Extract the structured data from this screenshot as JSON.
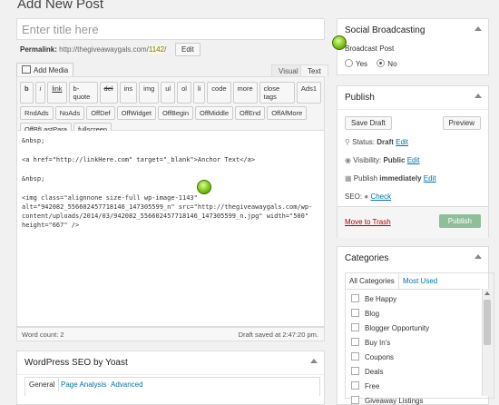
{
  "header": {
    "title": "Add New Post"
  },
  "title_input": {
    "placeholder": "Enter title here"
  },
  "permalink": {
    "label": "Permalink:",
    "url_prefix": "http://thegiveawaygals.com/",
    "slug": "1142",
    "url_suffix": "/",
    "edit_label": "Edit"
  },
  "media": {
    "add_label": "Add Media"
  },
  "editor_tabs": {
    "visual": "Visual",
    "text": "Text"
  },
  "quicktags": {
    "row1": [
      "b",
      "i",
      "link",
      "b-quote",
      "del",
      "ins",
      "img",
      "ul",
      "ol",
      "li",
      "code",
      "more",
      "close tags",
      "Ads1"
    ],
    "row2": [
      "RndAds",
      "NoAds",
      "OffDef",
      "OffWidget",
      "OffBegin",
      "OffMiddle",
      "OffEnd",
      "OffAfMore"
    ],
    "row3": [
      "OffBfLastPara",
      "fullscreen"
    ]
  },
  "editor_content": {
    "line1": "&nbsp;",
    "line2": "<a href=\"http://linkHere.com\" target=\"_blank\">Anchor Text</a>",
    "line3": "&nbsp;",
    "line4": "<img class=\"alignnone size-full wp-image-1143\" alt=\"942082_556602457718146_147305599_n\" src=\"http://thegiveawaygals.com/wp-content/uploads/2014/03/942082_556602457718146_147305599_n.jpg\" width=\"500\" height=\"667\" />"
  },
  "status_bar": {
    "word_count": "Word count: 2",
    "draft_saved": "Draft saved at 2:47:20 pm."
  },
  "seo": {
    "title": "WordPress SEO by Yoast",
    "tabs": [
      "General",
      "Page Analysis",
      "Advanced"
    ]
  },
  "social": {
    "title": "Social Broadcasting",
    "field_label": "Broadcast Post",
    "yes": "Yes",
    "no": "No",
    "selected": "No"
  },
  "publish": {
    "title": "Publish",
    "save_draft": "Save Draft",
    "preview": "Preview",
    "status_label": "Status:",
    "status_value": "Draft",
    "visibility_label": "Visibility:",
    "visibility_value": "Public",
    "schedule_label": "Publish",
    "schedule_value": "immediately",
    "edit": "Edit",
    "seo_label": "SEO:",
    "seo_check": "Check",
    "trash": "Move to Trash",
    "publish_btn": "Publish"
  },
  "categories": {
    "title": "Categories",
    "tab_all": "All Categories",
    "tab_used": "Most Used",
    "items": [
      "Be Happy",
      "Blog",
      "Blogger Opportunity",
      "Buy In's",
      "Coupons",
      "Deals",
      "Free",
      "Giveaway Listings"
    ]
  },
  "colors": {
    "link": "#0074a2",
    "pin_green": "#7fc21a",
    "publish_button": "#8fbf9a"
  }
}
